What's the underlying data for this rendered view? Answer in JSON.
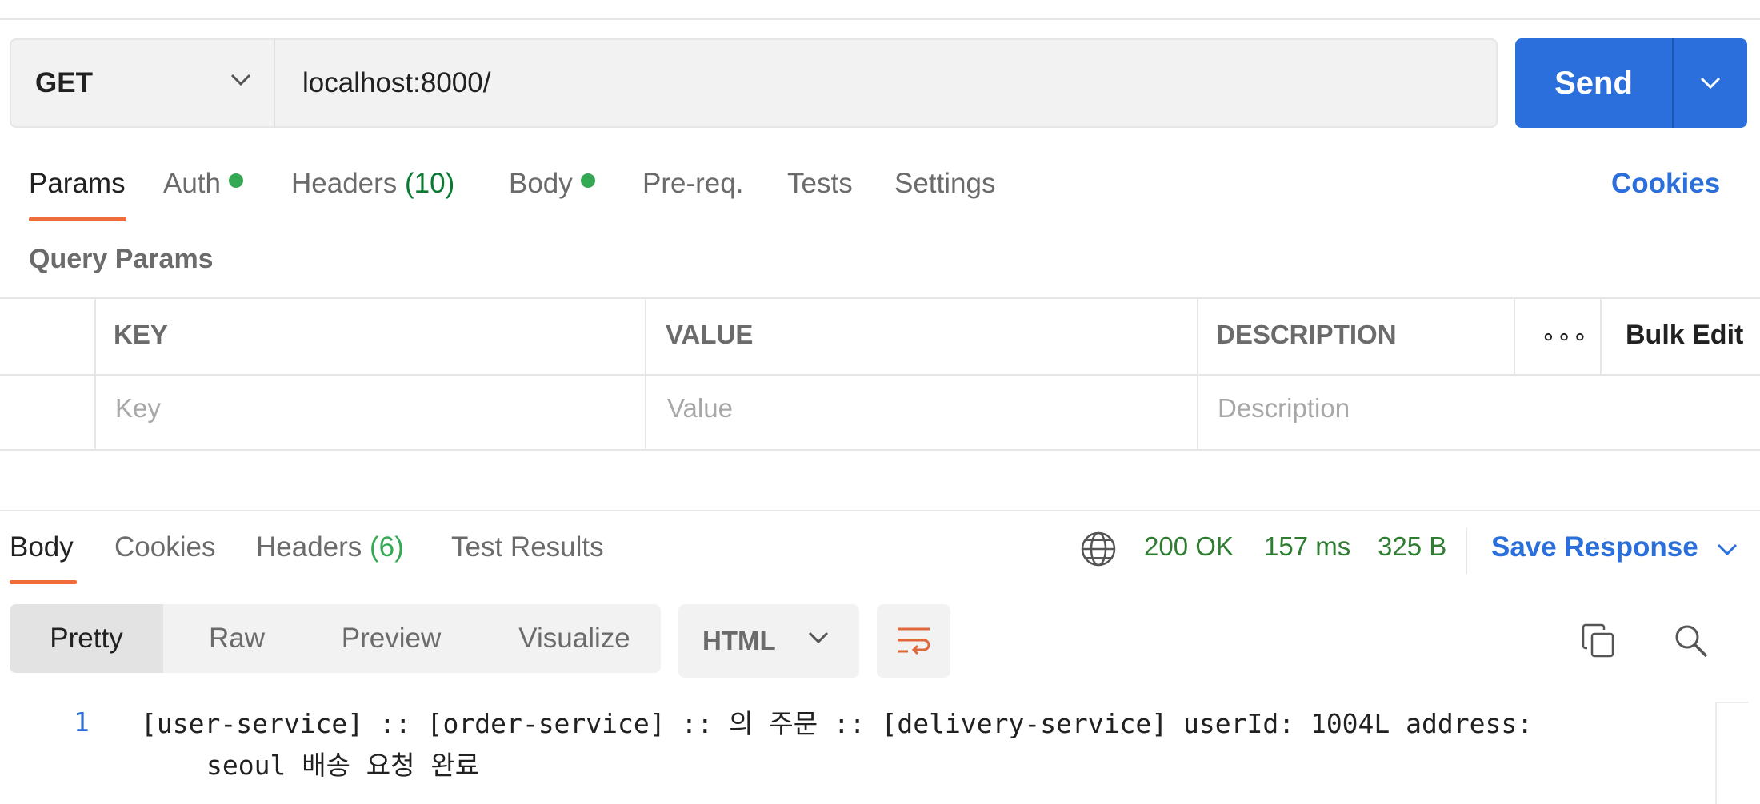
{
  "request": {
    "method": "GET",
    "url": "localhost:8000/",
    "send_label": "Send"
  },
  "request_tabs": {
    "params": "Params",
    "auth": "Auth",
    "headers": "Headers",
    "headers_count": "(10)",
    "body": "Body",
    "prereq": "Pre-req.",
    "tests": "Tests",
    "settings": "Settings",
    "cookies": "Cookies"
  },
  "query_params": {
    "label": "Query Params",
    "columns": {
      "key": "KEY",
      "value": "VALUE",
      "description": "DESCRIPTION"
    },
    "more": "∘∘∘",
    "bulk_edit": "Bulk Edit",
    "placeholders": {
      "key": "Key",
      "value": "Value",
      "description": "Description"
    }
  },
  "response_tabs": {
    "body": "Body",
    "cookies": "Cookies",
    "headers": "Headers",
    "headers_count": "(6)",
    "test_results": "Test Results"
  },
  "response_meta": {
    "status": "200 OK",
    "time": "157 ms",
    "size": "325 B",
    "save_label": "Save Response"
  },
  "viewer": {
    "modes": [
      "Pretty",
      "Raw",
      "Preview",
      "Visualize"
    ],
    "active_mode": "Pretty",
    "format": "HTML"
  },
  "response_body": {
    "line_number": "1",
    "line_1": "[user-service] :: [order-service] :: 의 주문 :: [delivery-service] userId: 1004L address:",
    "line_1_wrap": "seoul 배송 요청 완료"
  },
  "colors": {
    "accent_blue": "#2a6fdb",
    "tab_underline": "#ef6c3c",
    "status_green": "#2e7d32",
    "dot_green": "#34a853"
  },
  "icons": [
    "chevron-down-icon",
    "globe-icon",
    "wrap-lines-icon",
    "copy-icon",
    "search-icon"
  ]
}
